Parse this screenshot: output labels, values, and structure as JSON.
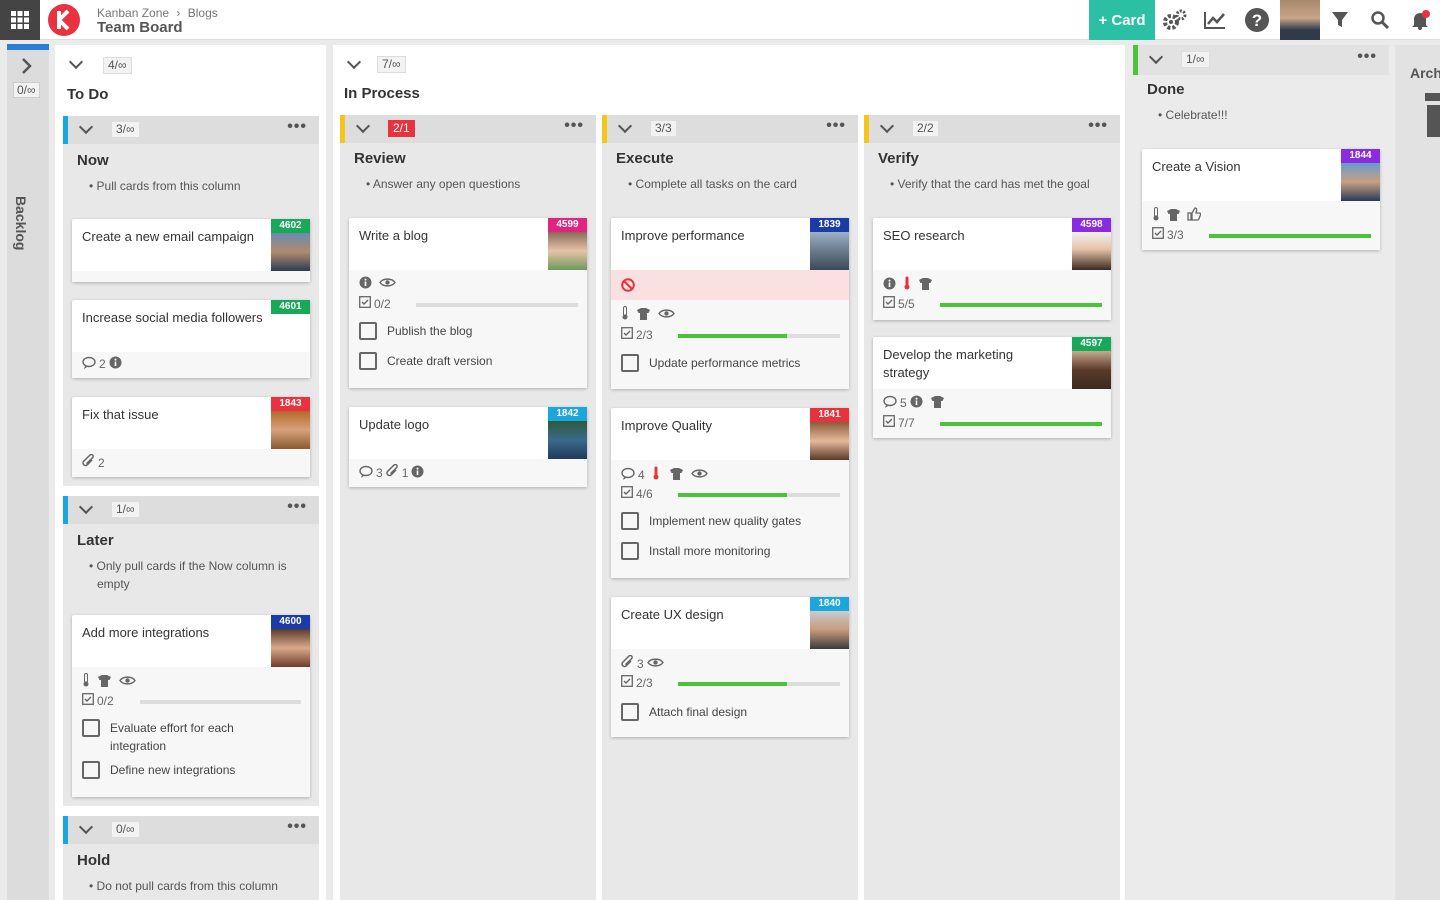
{
  "header": {
    "workspace": "Kanban Zone",
    "separator": "›",
    "section": "Blogs",
    "board": "Team Board",
    "add_card": "+ Card",
    "add_card_color": "#2bbfa4"
  },
  "backlog": {
    "label": "Backlog",
    "wip": "0/∞"
  },
  "archive": {
    "label": "Arch"
  },
  "columns": {
    "todo": {
      "title": "To Do",
      "wip": "4/∞"
    },
    "inprocess": {
      "title": "In Process",
      "wip": "7/∞"
    },
    "done": {
      "title": "Done",
      "wip": "1/∞",
      "note": "• Celebrate!!!"
    }
  },
  "lanes": {
    "now": {
      "title": "Now",
      "wip": "3/∞",
      "note": "• Pull cards from this column"
    },
    "later": {
      "title": "Later",
      "wip": "1/∞",
      "note": "• Only pull cards if the Now column is empty"
    },
    "hold": {
      "title": "Hold",
      "wip": "0/∞",
      "note": "• Do not pull cards from this column"
    },
    "review": {
      "title": "Review",
      "wip": "2/1",
      "note": "• Answer any open questions"
    },
    "execute": {
      "title": "Execute",
      "wip": "3/3",
      "note": "• Complete all tasks on the card"
    },
    "verify": {
      "title": "Verify",
      "wip": "2/2",
      "note": "• Verify that the card has met the goal"
    }
  },
  "cards": {
    "c4602": {
      "title": "Create a new email campaign",
      "id": "4602",
      "color": "#17a85a"
    },
    "c4601": {
      "title": "Increase social media followers",
      "id": "4601",
      "color": "#17a85a",
      "comments": "2"
    },
    "c1843": {
      "title": "Fix that issue",
      "id": "1843",
      "color": "#e8333e",
      "attachments": "2"
    },
    "c4600": {
      "title": "Add more integrations",
      "id": "4600",
      "color": "#1b3ca8",
      "checklist": "0/2",
      "progress": 0,
      "tasks": [
        "Evaluate effort for each integration",
        "Define new integrations"
      ]
    },
    "c4599": {
      "title": "Write a blog",
      "id": "4599",
      "color": "#e0247f",
      "checklist": "0/2",
      "progress": 0,
      "tasks": [
        "Publish the blog",
        "Create draft version"
      ]
    },
    "c1842": {
      "title": "Update logo",
      "id": "1842",
      "color": "#1ba7dd",
      "comments": "3",
      "attachments": "1"
    },
    "c1839": {
      "title": "Improve performance",
      "id": "1839",
      "color": "#1b3ca8",
      "checklist": "2/3",
      "progress": 0.67,
      "tasks": [
        "Update performance metrics"
      ]
    },
    "c1841": {
      "title": "Improve Quality",
      "id": "1841",
      "color": "#e8333e",
      "comments": "4",
      "checklist": "4/6",
      "progress": 0.67,
      "tasks": [
        "Implement new quality gates",
        "Install more monitoring"
      ]
    },
    "c1840": {
      "title": "Create UX design",
      "id": "1840",
      "color": "#1ba7dd",
      "attachments": "3",
      "checklist": "2/3",
      "progress": 0.67,
      "tasks": [
        "Attach final design"
      ]
    },
    "c4598": {
      "title": "SEO research",
      "id": "4598",
      "color": "#8a2be2",
      "checklist": "5/5",
      "progress": 1
    },
    "c4597": {
      "title": "Develop the marketing strategy",
      "id": "4597",
      "color": "#17a85a",
      "comments": "5",
      "checklist": "7/7",
      "progress": 1
    },
    "c1844": {
      "title": "Create a Vision",
      "id": "1844",
      "color": "#8a2be2",
      "checklist": "3/3",
      "progress": 1
    }
  }
}
